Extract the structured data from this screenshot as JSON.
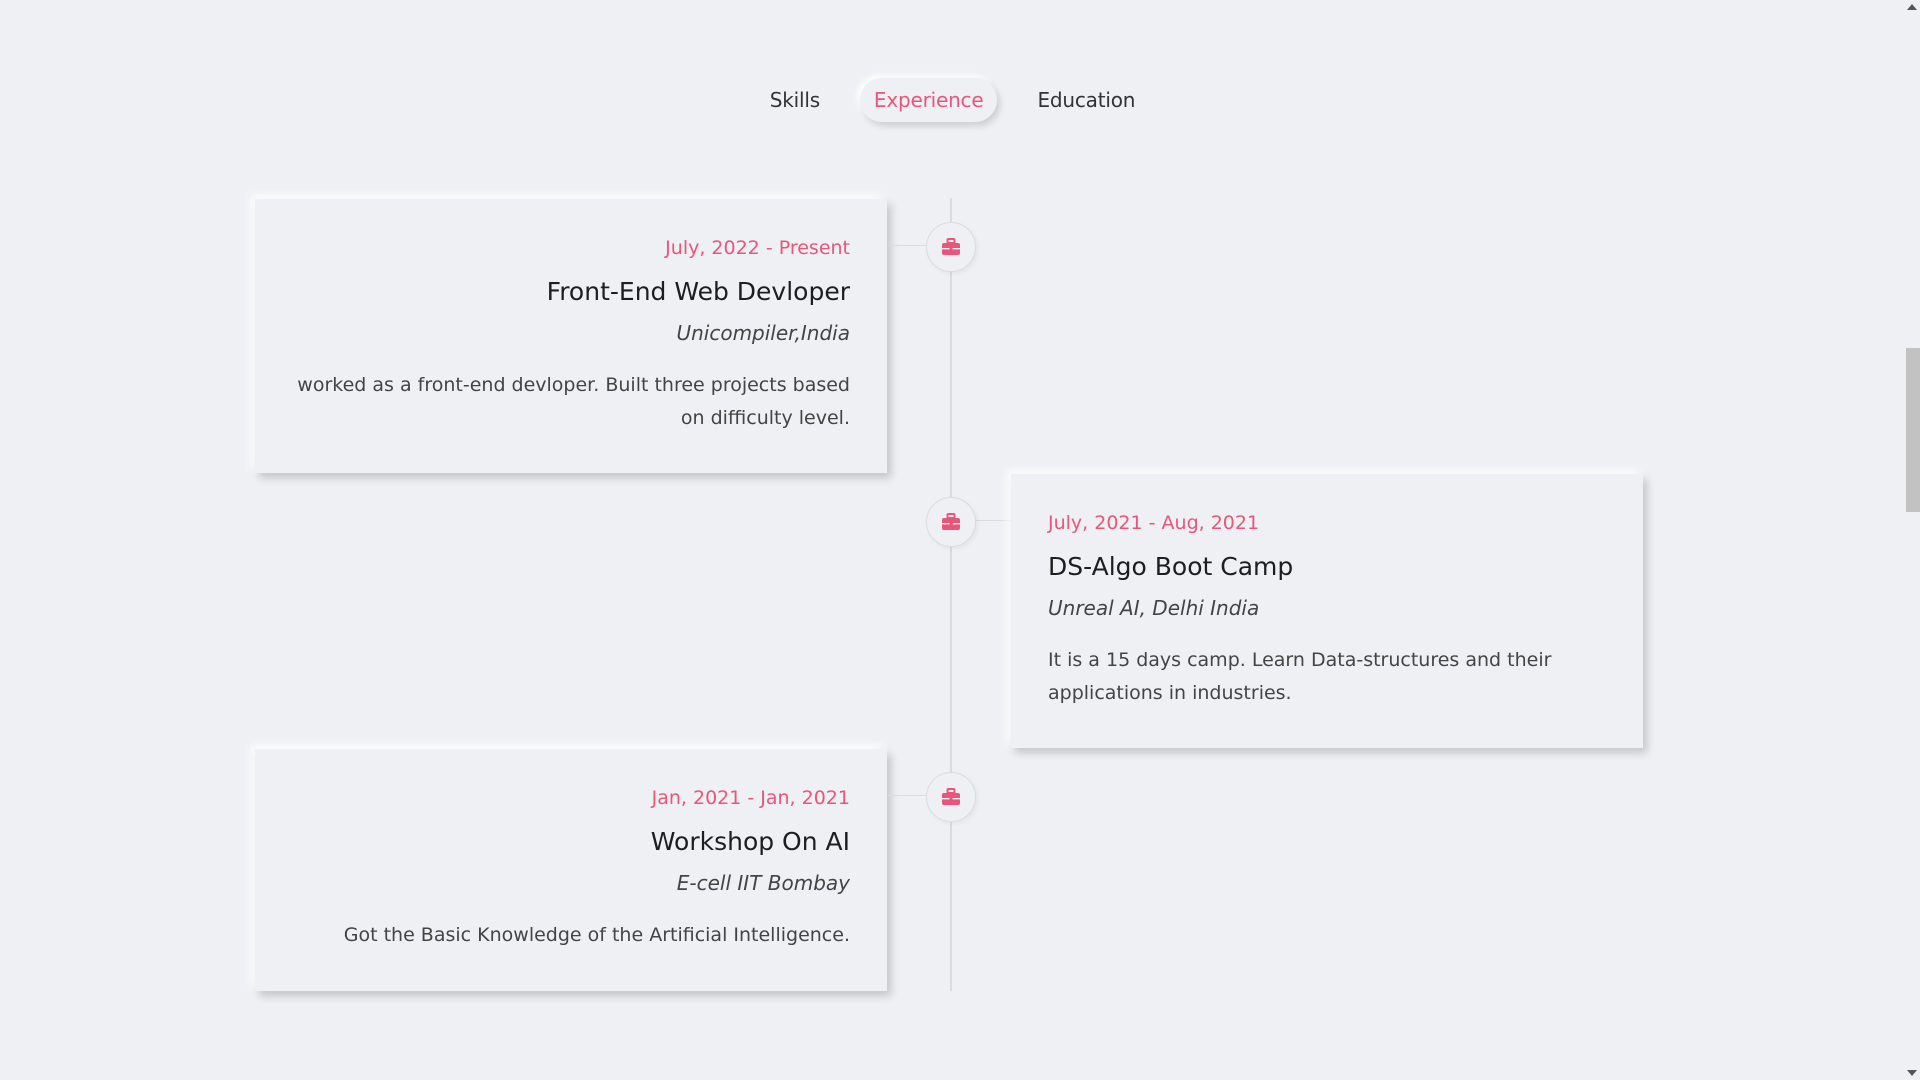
{
  "tabs": [
    {
      "label": "Skills",
      "active": false
    },
    {
      "label": "Experience",
      "active": true
    },
    {
      "label": "Education",
      "active": false
    }
  ],
  "accent_color": "#e9557b",
  "timeline": {
    "icon": "briefcase-icon",
    "items": [
      {
        "date": "July, 2022 - Present",
        "title": "Front-End Web Devloper",
        "org": "Unicompiler,India",
        "desc": "worked as a front-end devloper. Built three projects based on difficulty level."
      },
      {
        "date": "July, 2021 - Aug, 2021",
        "title": "DS-Algo Boot Camp",
        "org": "Unreal AI, Delhi India",
        "desc": "It is a 15 days camp. Learn Data-structures and their applications in industries."
      },
      {
        "date": "Jan, 2021 - Jan, 2021",
        "title": "Workshop On AI",
        "org": "E-cell IIT Bombay",
        "desc": "Got the Basic Knowledge of the Artificial Intelligence."
      }
    ]
  }
}
